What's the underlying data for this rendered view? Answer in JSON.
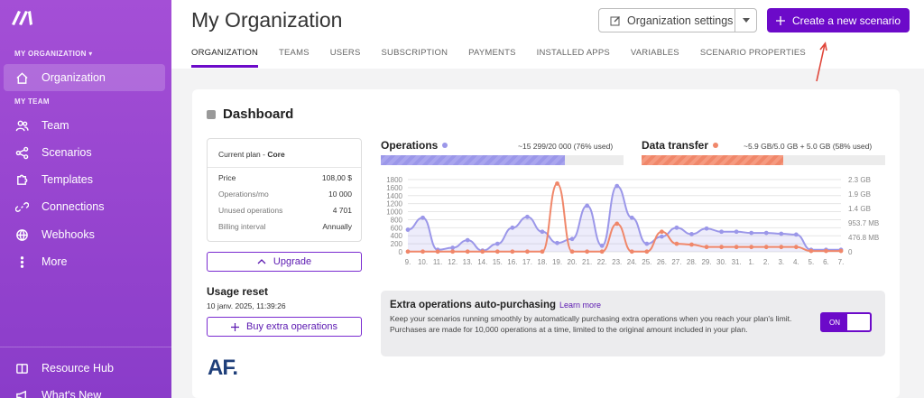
{
  "sidebar": {
    "org_label": "MY ORGANIZATION ▾",
    "team_label": "MY TEAM",
    "items": [
      {
        "label": "Organization"
      },
      {
        "label": "Team"
      },
      {
        "label": "Scenarios"
      },
      {
        "label": "Templates"
      },
      {
        "label": "Connections"
      },
      {
        "label": "Webhooks"
      },
      {
        "label": "More"
      }
    ],
    "bottom": [
      {
        "label": "Resource Hub"
      },
      {
        "label": "What's New"
      }
    ]
  },
  "header": {
    "title": "My Organization",
    "settings_label": "Organization settings",
    "create_label": "Create a new scenario",
    "tabs": [
      "ORGANIZATION",
      "TEAMS",
      "USERS",
      "SUBSCRIPTION",
      "PAYMENTS",
      "INSTALLED APPS",
      "VARIABLES",
      "SCENARIO PROPERTIES"
    ]
  },
  "dashboard": {
    "title": "Dashboard",
    "plan": {
      "heading_prefix": "Current plan - ",
      "heading_plan": "Core",
      "rows": [
        {
          "k": "Price",
          "v": "108,00 $"
        },
        {
          "k": "Operations/mo",
          "v": "10 000"
        },
        {
          "k": "Unused operations",
          "v": "4 701"
        },
        {
          "k": "Billing interval",
          "v": "Annually"
        }
      ]
    },
    "upgrade_label": "Upgrade",
    "usage_reset_title": "Usage reset",
    "usage_reset_date": "10 janv. 2025, 11:39:26",
    "buy_label": "Buy extra operations",
    "logo_text": "AF.",
    "operations": {
      "title": "Operations",
      "used_text": "~15 299/20 000 (76% used)",
      "percent": 76,
      "color": "#9b97e9"
    },
    "data_transfer": {
      "title": "Data transfer",
      "used_text": "~5.9 GB/5.0 GB + 5.0 GB (58% used)",
      "percent": 58,
      "color": "#f0876a"
    },
    "promo": {
      "title": "Extra operations auto-purchasing",
      "learn_more": "Learn more",
      "desc": "Keep your scenarios running smoothly by automatically purchasing extra operations when you reach your plan's limit. Purchases are made for 10,000 operations at a time, limited to the original amount included in your plan.",
      "toggle_label": "ON"
    }
  },
  "chart_data": {
    "type": "line",
    "categories": [
      "9.",
      "10.",
      "11.",
      "12.",
      "13.",
      "14.",
      "15.",
      "16.",
      "17.",
      "18.",
      "19.",
      "20.",
      "21.",
      "22.",
      "23.",
      "24.",
      "25.",
      "26.",
      "27.",
      "28.",
      "29.",
      "30.",
      "31.",
      "1.",
      "2.",
      "3.",
      "4.",
      "5.",
      "6.",
      "7."
    ],
    "y_left_ticks": [
      "1800",
      "1600",
      "1400",
      "1200",
      "1000",
      "800",
      "600",
      "400",
      "200",
      "0"
    ],
    "y_right_ticks": [
      "2.3 GB",
      "1.9 GB",
      "1.4 GB",
      "953.7 MB",
      "476.8 MB",
      "0"
    ],
    "ylim": [
      0,
      1800
    ],
    "series": [
      {
        "name": "Operations",
        "color": "#9b97e9",
        "values": [
          550,
          850,
          50,
          100,
          290,
          30,
          200,
          600,
          870,
          500,
          220,
          320,
          1150,
          150,
          1640,
          850,
          200,
          380,
          600,
          440,
          580,
          500,
          500,
          470,
          470,
          450,
          430,
          50,
          50,
          50
        ]
      },
      {
        "name": "Data transfer",
        "color": "#f0876a",
        "values": [
          5,
          5,
          5,
          5,
          5,
          5,
          5,
          5,
          5,
          5,
          1700,
          5,
          5,
          5,
          700,
          5,
          5,
          500,
          200,
          180,
          120,
          120,
          120,
          120,
          120,
          120,
          120,
          20,
          20,
          20
        ]
      }
    ]
  }
}
